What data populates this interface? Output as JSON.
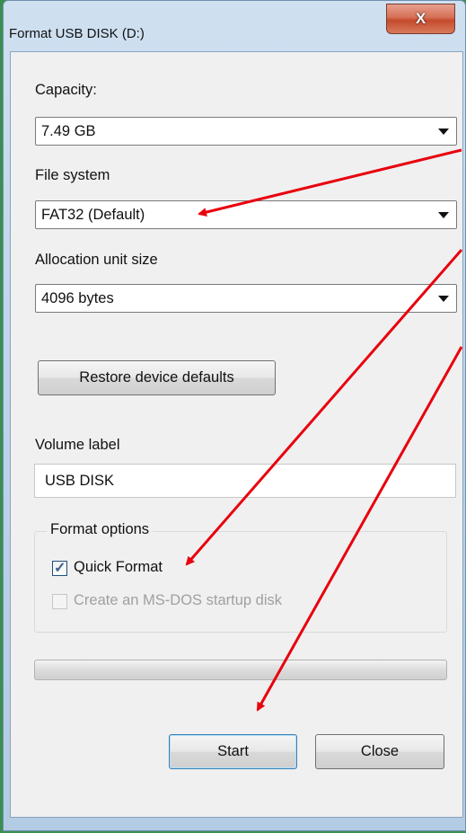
{
  "window": {
    "title": "Format USB DISK (D:)",
    "close_glyph": "X"
  },
  "capacity": {
    "label": "Capacity:",
    "value": "7.49 GB"
  },
  "file_system": {
    "label": "File system",
    "value": "FAT32 (Default)"
  },
  "allocation": {
    "label": "Allocation unit size",
    "value": "4096 bytes"
  },
  "restore_button": "Restore device defaults",
  "volume": {
    "label": "Volume label",
    "value": "USB DISK"
  },
  "format_options": {
    "title": "Format options",
    "quick_format": {
      "label": "Quick Format",
      "checked": true
    },
    "msdos": {
      "label": "Create an MS-DOS startup disk",
      "checked": false,
      "disabled": true
    }
  },
  "progress": {
    "value": 0
  },
  "buttons": {
    "start": "Start",
    "close": "Close"
  },
  "annotation_color": "#e8000d"
}
